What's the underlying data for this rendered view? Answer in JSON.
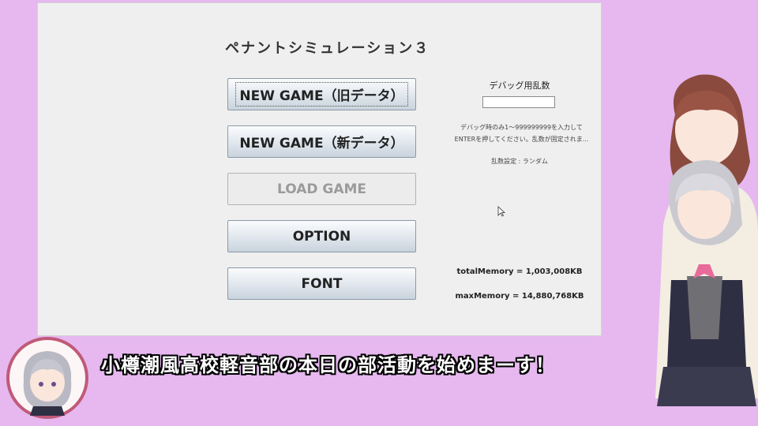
{
  "app": {
    "title": "ペナントシミュレーション３"
  },
  "menu": {
    "new_game_old": "NEW GAME（旧データ）",
    "new_game_new": "NEW GAME（新データ）",
    "load_game": "LOAD GAME",
    "option": "OPTION",
    "font": "FONT"
  },
  "debug": {
    "title": "デバッグ用乱数",
    "input_value": "",
    "help_line1": "デバッグ時のみ1～999999999を入力して",
    "help_line2": "ENTERを押してください。乱数が固定されま...",
    "seed_status": "乱数設定 : ランダム"
  },
  "memory": {
    "total": "totalMemory = 1,003,008KB",
    "max": "maxMemory = 14,880,768KB"
  },
  "overlay": {
    "subtitle": "小樽潮風高校軽音部の本日の部活動を始めまーす！"
  },
  "colors": {
    "background": "#e6b8ef",
    "window": "#efefef"
  }
}
